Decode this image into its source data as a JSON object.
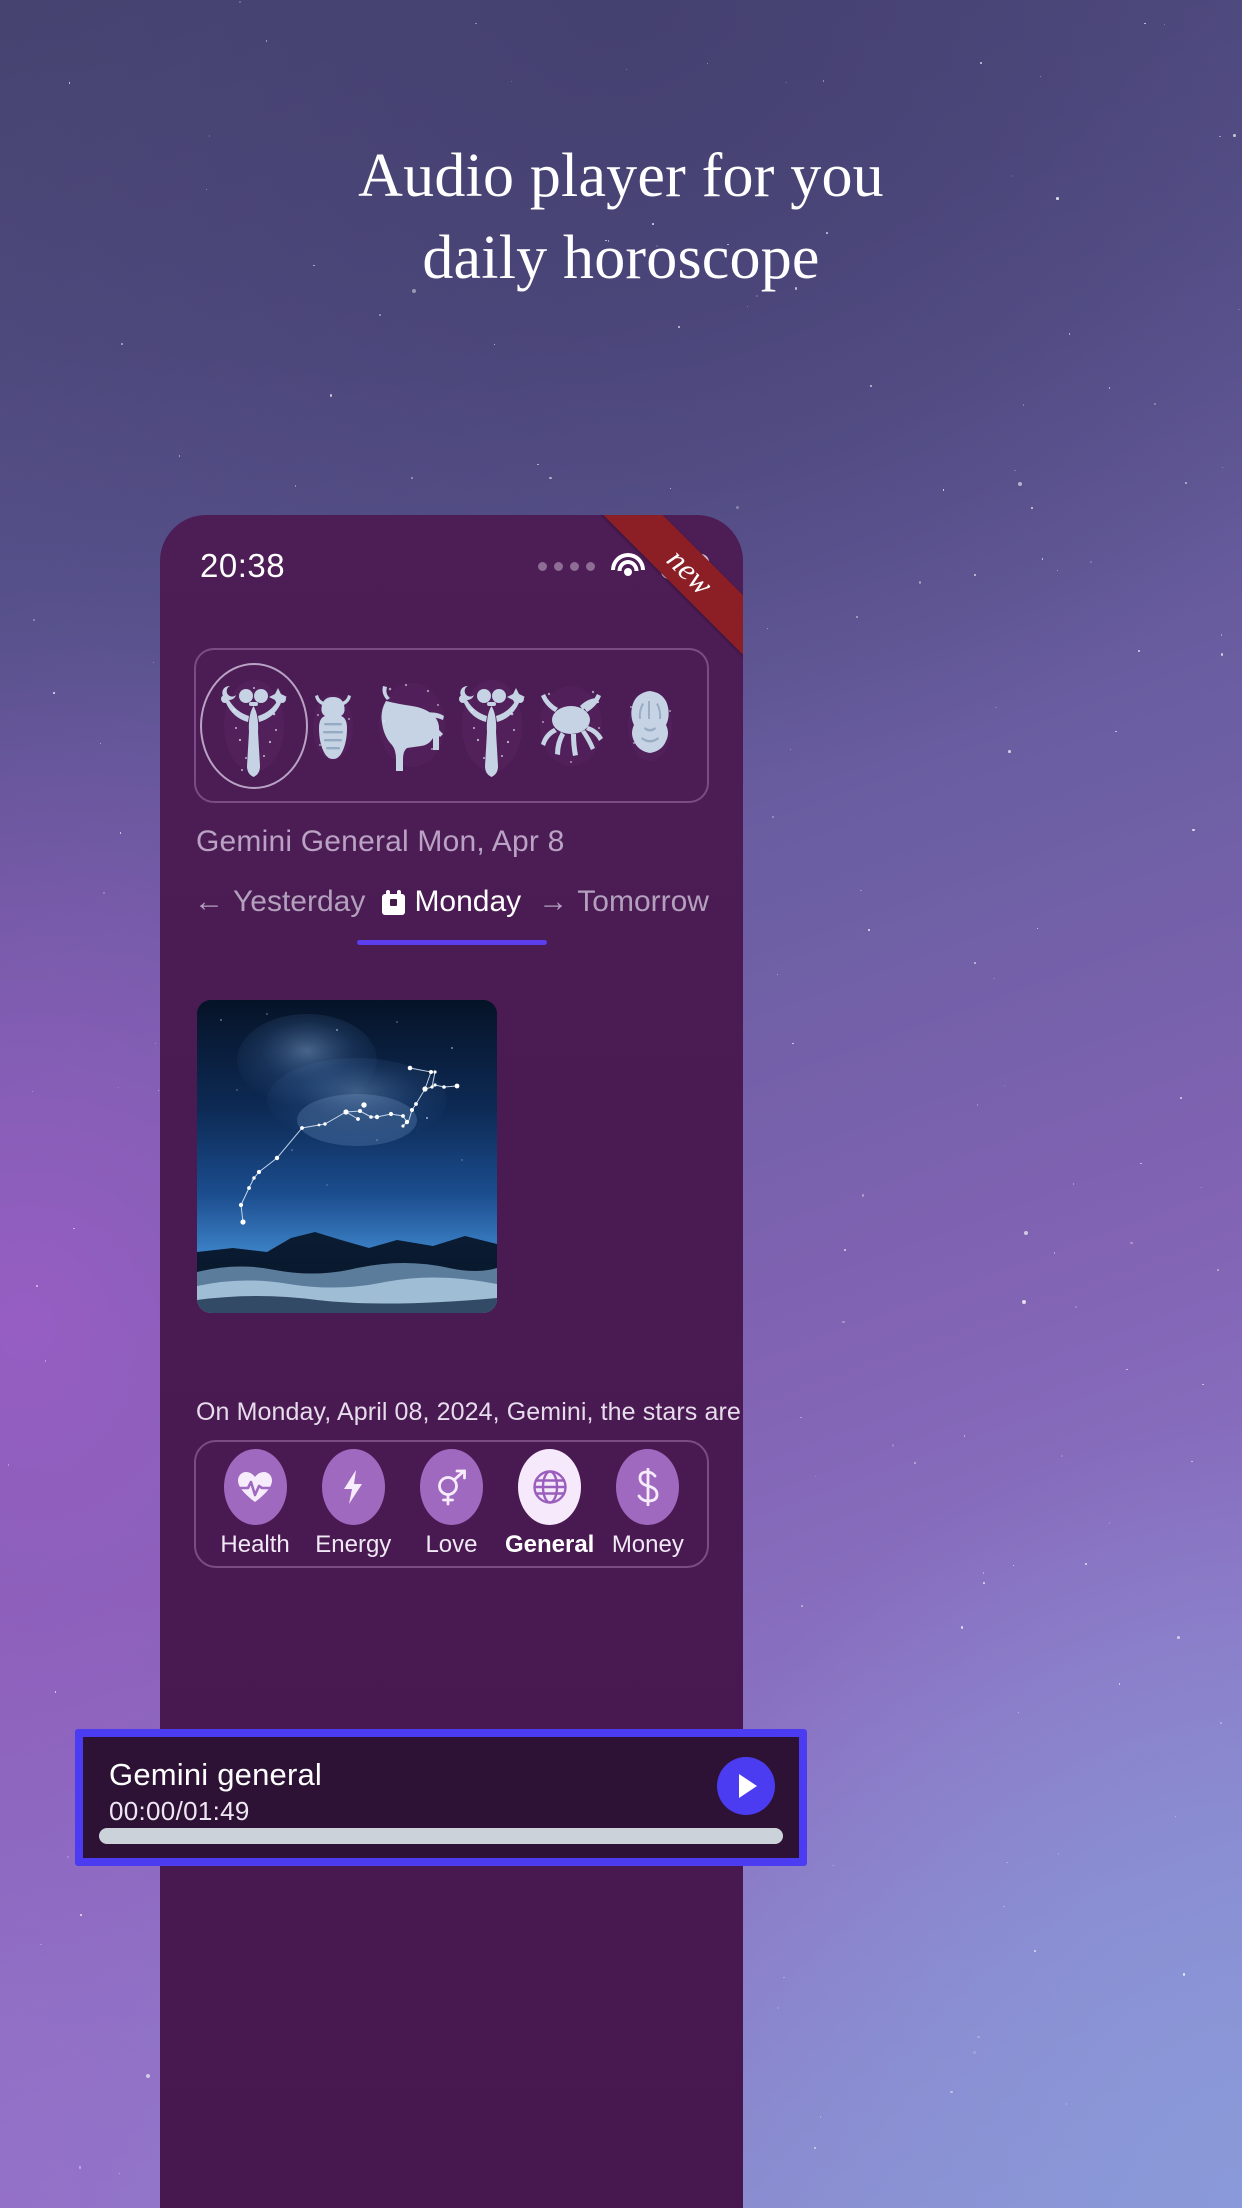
{
  "page": {
    "headline_line1": "Audio player for you",
    "headline_line2": "daily horoscope"
  },
  "phone": {
    "status_bar": {
      "time": "20:38",
      "icons": [
        "signal-dots-icon",
        "wifi-icon",
        "battery-icon"
      ]
    },
    "ribbon": {
      "label": "new",
      "color": "#8c1f26"
    },
    "zodiac_strip": {
      "signs": [
        {
          "name": "Gemini",
          "icon": "zodiac-gemini-icon",
          "selected": true
        },
        {
          "name": "Aries",
          "icon": "zodiac-aries-icon",
          "selected": false
        },
        {
          "name": "Taurus",
          "icon": "zodiac-taurus-icon",
          "selected": false
        },
        {
          "name": "Gemini",
          "icon": "zodiac-gemini-icon",
          "selected": false
        },
        {
          "name": "Cancer",
          "icon": "zodiac-cancer-icon",
          "selected": false
        },
        {
          "name": "Leo",
          "icon": "zodiac-leo-icon",
          "selected": false
        }
      ]
    },
    "caption": "Gemini General Mon, Apr 8",
    "day_tabs": {
      "yesterday": {
        "label": "Yesterday",
        "arrow": "←",
        "active": false
      },
      "today": {
        "label": "Monday",
        "icon": "calendar-icon",
        "active": true
      },
      "tomorrow": {
        "label": "Tomorrow",
        "arrow": "→",
        "active": false
      }
    },
    "constellation": {
      "alt": "Gemini constellation over night landscape"
    },
    "horoscope_text": "On Monday, April 08, 2024, Gemini, the stars are",
    "categories": [
      {
        "label": "Health",
        "icon": "heartbeat-icon",
        "selected": false
      },
      {
        "label": "Energy",
        "icon": "lightning-icon",
        "selected": false
      },
      {
        "label": "Love",
        "icon": "gender-icon",
        "selected": false
      },
      {
        "label": "General",
        "icon": "globe-icon",
        "selected": true
      },
      {
        "label": "Money",
        "icon": "dollar-icon",
        "selected": false
      }
    ]
  },
  "player": {
    "title": "Gemini general",
    "time": "00:00/01:49",
    "current_seconds": 0,
    "total_label": "01:49",
    "progress_percent": 0,
    "play_icon": "play-icon",
    "accent_color": "#4b3cf2",
    "background_color": "#2d1236"
  },
  "colors": {
    "headline": "#ffffff",
    "phone_body": "#4a1a52",
    "muted_text": "#b9a2c3",
    "active_tab_underline": "#5b3fef",
    "category_bubble": "#a069c0",
    "category_bubble_selected": "#f6e9fb"
  }
}
